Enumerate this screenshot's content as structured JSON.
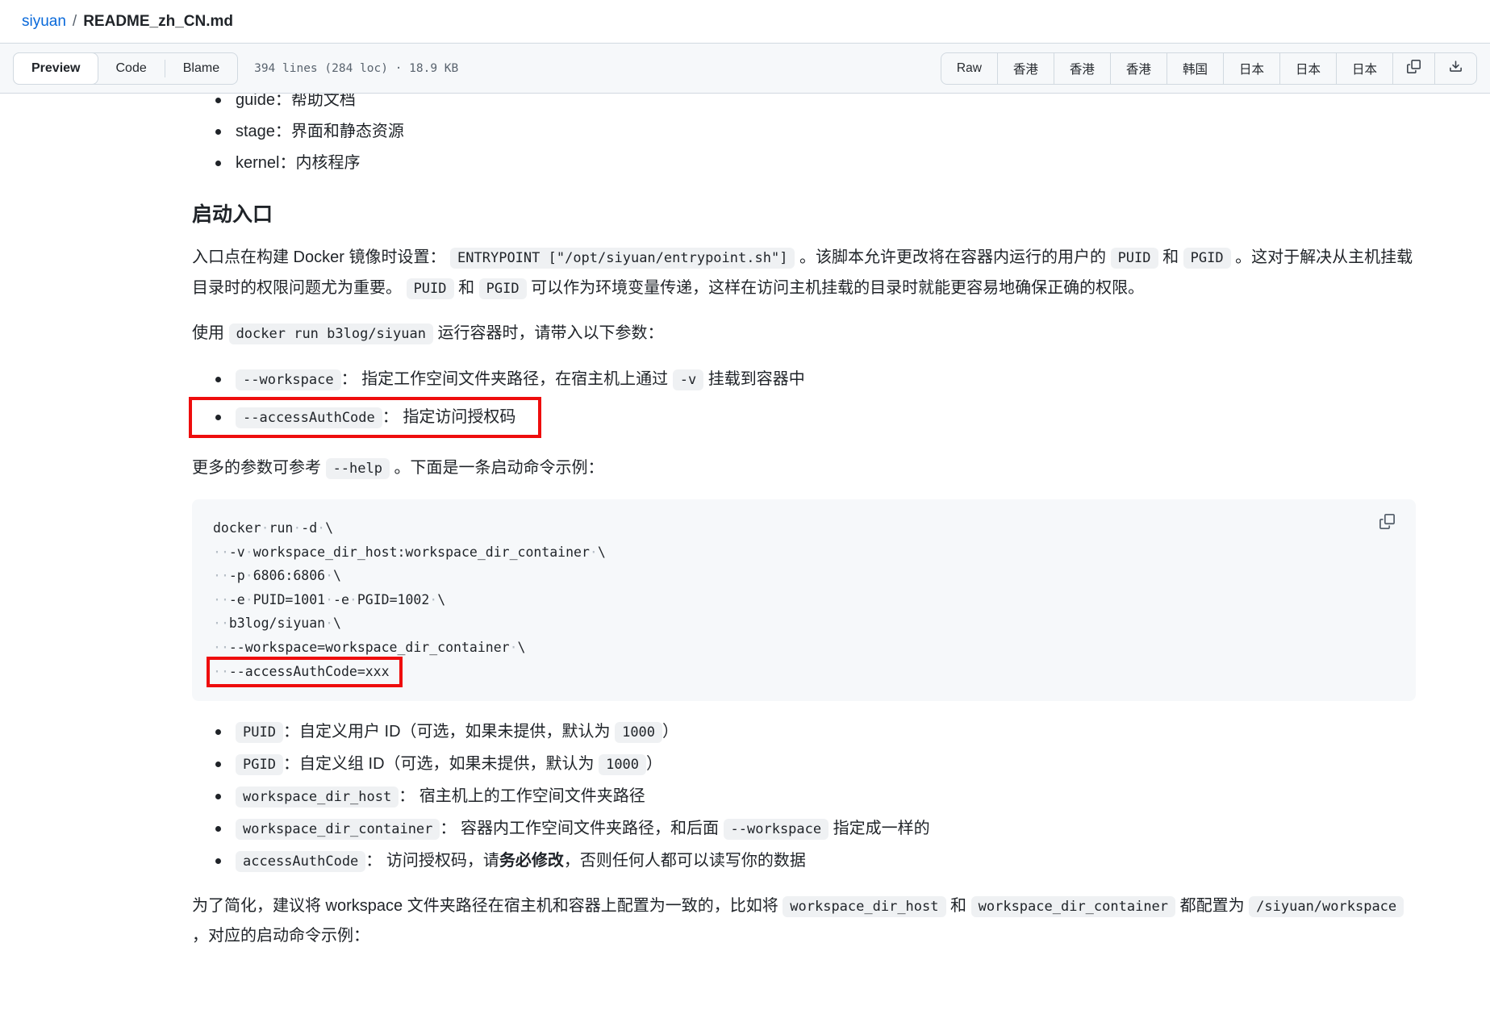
{
  "colors": {
    "link": "#0969da",
    "text": "#1f2328",
    "muted": "#59636e",
    "toolbar_bg": "#f6f8fa",
    "border": "#d1d9e0",
    "inline_code_bg": "#eff1f3",
    "code_block_bg": "#f6f8fa",
    "annotation_red": "#ee0d0d"
  },
  "header": {
    "breadcrumb": {
      "repo": "siyuan",
      "separator": "/",
      "file": "README_zh_CN.md"
    },
    "tabs": [
      {
        "label": "Preview",
        "active": true
      },
      {
        "label": "Code",
        "active": false
      },
      {
        "label": "Blame",
        "active": false
      }
    ],
    "file_meta": "394 lines (284 loc) · 18.9 KB",
    "actions": [
      {
        "label": "Raw"
      },
      {
        "label": "香港"
      },
      {
        "label": "香港"
      },
      {
        "label": "香港"
      },
      {
        "label": "韩国"
      },
      {
        "label": "日本"
      },
      {
        "label": "日本"
      },
      {
        "label": "日本"
      }
    ],
    "icon_actions": [
      {
        "icon": "copy-icon"
      },
      {
        "icon": "download-icon"
      }
    ]
  },
  "document": {
    "top_list": [
      {
        "clipped": true,
        "segments": [
          {
            "t": "guide：帮助文档"
          }
        ]
      },
      {
        "segments": [
          {
            "t": "stage：界面和静态资源"
          }
        ]
      },
      {
        "segments": [
          {
            "t": "kernel：内核程序"
          }
        ]
      }
    ],
    "heading": "启动入口",
    "para_entrypoint": [
      {
        "t": "入口点在构建 Docker 镜像时设置： "
      },
      {
        "c": "ENTRYPOINT [\"/opt/siyuan/entrypoint.sh\"]"
      },
      {
        "t": " 。该脚本允许更改将在容器内运行的用户的 "
      },
      {
        "c": "PUID"
      },
      {
        "t": " 和 "
      },
      {
        "c": "PGID"
      },
      {
        "t": " 。这对于解决从主机挂载目录时的权限问题尤为重要。 "
      },
      {
        "c": "PUID"
      },
      {
        "t": " 和 "
      },
      {
        "c": "PGID"
      },
      {
        "t": " 可以作为环境变量传递，这样在访问主机挂载的目录时就能更容易地确保正确的权限。"
      }
    ],
    "para_docker_run": [
      {
        "t": "使用 "
      },
      {
        "c": "docker run b3log/siyuan"
      },
      {
        "t": " 运行容器时，请带入以下参数："
      }
    ],
    "args_list": [
      {
        "segments": [
          {
            "c": "--workspace"
          },
          {
            "t": "： 指定工作空间文件夹路径，在宿主机上通过 "
          },
          {
            "c": "-v"
          },
          {
            "t": " 挂载到容器中"
          }
        ]
      },
      {
        "highlighted": true,
        "segments": [
          {
            "c": "--accessAuthCode"
          },
          {
            "t": "： 指定访问授权码"
          }
        ]
      }
    ],
    "para_more": [
      {
        "t": "更多的参数可参考 "
      },
      {
        "c": "--help"
      },
      {
        "t": " 。下面是一条启动命令示例："
      }
    ],
    "code_block": {
      "lines": [
        "docker run -d \\",
        "  -v workspace_dir_host:workspace_dir_container \\",
        "  -p 6806:6806 \\",
        "  -e PUID=1001 -e PGID=1002 \\",
        "  b3log/siyuan \\",
        "  --workspace=workspace_dir_container \\",
        "  --accessAuthCode=xxx"
      ],
      "highlighted_line": 6,
      "copy_icon": "copy-icon"
    },
    "env_list": [
      {
        "segments": [
          {
            "c": "PUID"
          },
          {
            "t": "：自定义用户 ID（可选，如果未提供，默认为 "
          },
          {
            "c": "1000"
          },
          {
            "t": "）"
          }
        ]
      },
      {
        "segments": [
          {
            "c": "PGID"
          },
          {
            "t": "：自定义组 ID（可选，如果未提供，默认为 "
          },
          {
            "c": "1000"
          },
          {
            "t": "）"
          }
        ]
      },
      {
        "segments": [
          {
            "c": "workspace_dir_host"
          },
          {
            "t": "： 宿主机上的工作空间文件夹路径"
          }
        ]
      },
      {
        "segments": [
          {
            "c": "workspace_dir_container"
          },
          {
            "t": "： 容器内工作空间文件夹路径，和后面 "
          },
          {
            "c": "--workspace"
          },
          {
            "t": " 指定成一样的"
          }
        ]
      },
      {
        "segments": [
          {
            "c": "accessAuthCode"
          },
          {
            "t": "： 访问授权码，请"
          },
          {
            "b": "务必修改"
          },
          {
            "t": "，否则任何人都可以读写你的数据"
          }
        ]
      }
    ],
    "para_simplify": [
      {
        "t": "为了简化，建议将 workspace 文件夹路径在宿主机和容器上配置为一致的，比如将 "
      },
      {
        "c": "workspace_dir_host"
      },
      {
        "t": " 和 "
      },
      {
        "c": "workspace_dir_container"
      },
      {
        "t": " 都配置为 "
      },
      {
        "c": "/siyuan/workspace"
      },
      {
        "t": " ，对应的启动命令示例："
      }
    ]
  }
}
